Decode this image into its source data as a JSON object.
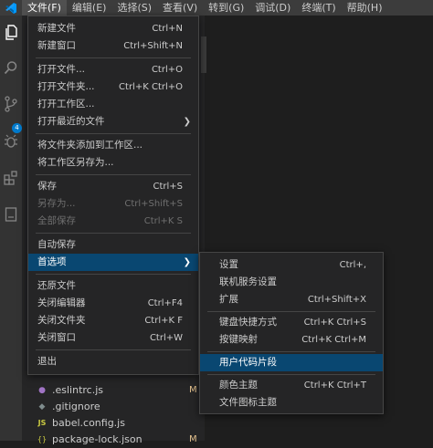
{
  "menubar": {
    "items": [
      "文件(F)",
      "编辑(E)",
      "选择(S)",
      "查看(V)",
      "转到(G)",
      "调试(D)",
      "终端(T)",
      "帮助(H)"
    ]
  },
  "activitybar": {
    "badge": "4"
  },
  "file_menu": {
    "items": [
      {
        "label": "新建文件",
        "shortcut": "Ctrl+N"
      },
      {
        "label": "新建窗口",
        "shortcut": "Ctrl+Shift+N"
      },
      {
        "label": "打开文件...",
        "shortcut": "Ctrl+O"
      },
      {
        "label": "打开文件夹...",
        "shortcut": "Ctrl+K Ctrl+O"
      },
      {
        "label": "打开工作区...",
        "shortcut": ""
      },
      {
        "label": "打开最近的文件",
        "shortcut": ""
      },
      {
        "label": "将文件夹添加到工作区...",
        "shortcut": ""
      },
      {
        "label": "将工作区另存为...",
        "shortcut": ""
      },
      {
        "label": "保存",
        "shortcut": "Ctrl+S"
      },
      {
        "label": "另存为...",
        "shortcut": "Ctrl+Shift+S"
      },
      {
        "label": "全部保存",
        "shortcut": "Ctrl+K S"
      },
      {
        "label": "自动保存",
        "shortcut": ""
      },
      {
        "label": "首选项",
        "shortcut": ""
      },
      {
        "label": "还原文件",
        "shortcut": ""
      },
      {
        "label": "关闭编辑器",
        "shortcut": "Ctrl+F4"
      },
      {
        "label": "关闭文件夹",
        "shortcut": "Ctrl+K F"
      },
      {
        "label": "关闭窗口",
        "shortcut": "Ctrl+W"
      },
      {
        "label": "退出",
        "shortcut": ""
      }
    ]
  },
  "pref_menu": {
    "items": [
      {
        "label": "设置",
        "shortcut": "Ctrl+,"
      },
      {
        "label": "联机服务设置",
        "shortcut": ""
      },
      {
        "label": "扩展",
        "shortcut": "Ctrl+Shift+X"
      },
      {
        "label": "键盘快捷方式",
        "shortcut": "Ctrl+K Ctrl+S"
      },
      {
        "label": "按键映射",
        "shortcut": "Ctrl+K Ctrl+M"
      },
      {
        "label": "用户代码片段",
        "shortcut": ""
      },
      {
        "label": "颜色主题",
        "shortcut": "Ctrl+K Ctrl+T"
      },
      {
        "label": "文件图标主题",
        "shortcut": ""
      }
    ]
  },
  "explorer": {
    "files": [
      {
        "name": ".eslintrc.js",
        "icon": "●",
        "icon_color": "#a074c4",
        "status": "M"
      },
      {
        "name": ".gitignore",
        "icon": "◆",
        "icon_color": "#7f8c8d",
        "status": ""
      },
      {
        "name": "babel.config.js",
        "icon": "JS",
        "icon_color": "#cbcb41",
        "status": ""
      },
      {
        "name": "package-lock.json",
        "icon": "{}",
        "icon_color": "#cbcb41",
        "status": "M"
      }
    ]
  }
}
